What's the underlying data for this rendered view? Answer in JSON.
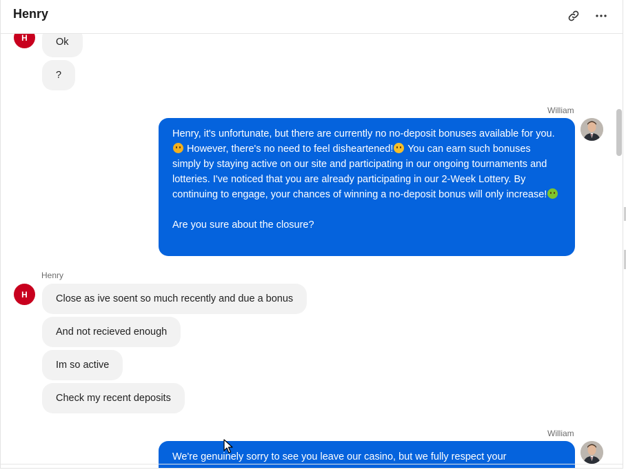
{
  "header": {
    "title": "Henry",
    "link_icon": "link-icon",
    "more_icon": "more-horizontal-icon"
  },
  "colors": {
    "accent": "#0563dd",
    "customer_avatar": "#c8001e",
    "incoming_bubble": "#f2f2f2"
  },
  "customer": {
    "name": "Henry",
    "initial": "H"
  },
  "agent": {
    "name": "William"
  },
  "messages_top": [
    "Ok",
    "?"
  ],
  "agent_message_1": {
    "sender": "William",
    "line1": "Henry, it's unfortunate, but there are currently no no-deposit bonuses available for you.",
    "line2": " However, there's no need to feel disheartened!",
    "line3": " You can earn such bonuses simply by staying active on our site and participating in our ongoing tournaments and lotteries. I've noticed that you are already participating in our 2-Week Lottery. By continuing to engage, your chances of winning a no-deposit bonus will only increase!",
    "question": "Are you sure about the closure?"
  },
  "customer_group": {
    "sender": "Henry",
    "messages": [
      "Close as ive soent so much recently and due a bonus",
      "And not recieved enough",
      "Im so active",
      "Check my recent deposits"
    ]
  },
  "agent_message_2": {
    "sender": "William",
    "text": "We're genuinely sorry to see you leave our casino, but we fully respect your"
  }
}
